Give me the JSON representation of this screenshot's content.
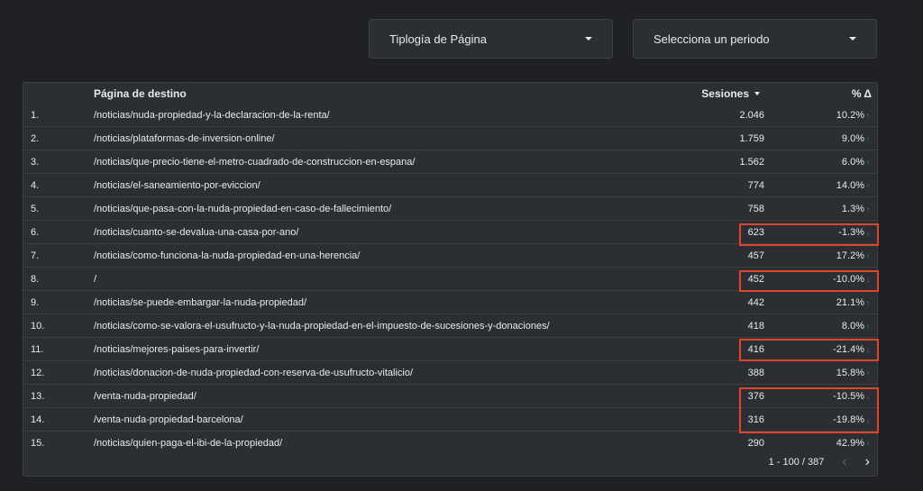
{
  "filters": {
    "tipologia": "Tiplogía de Página",
    "periodo": "Selecciona un periodo"
  },
  "table": {
    "headers": {
      "page": "Página de destino",
      "sessions": "Sesiones",
      "delta": "% Δ"
    },
    "rows": [
      {
        "idx": "1.",
        "page": "/noticias/nuda-propiedad-y-la-declaracion-de-la-renta/",
        "sessions": "2.046",
        "delta": "10.2%",
        "dir": "up"
      },
      {
        "idx": "2.",
        "page": "/noticias/plataformas-de-inversion-online/",
        "sessions": "1.759",
        "delta": "9.0%",
        "dir": "up"
      },
      {
        "idx": "3.",
        "page": "/noticias/que-precio-tiene-el-metro-cuadrado-de-construccion-en-espana/",
        "sessions": "1.562",
        "delta": "6.0%",
        "dir": "up"
      },
      {
        "idx": "4.",
        "page": "/noticias/el-saneamiento-por-eviccion/",
        "sessions": "774",
        "delta": "14.0%",
        "dir": "up"
      },
      {
        "idx": "5.",
        "page": "/noticias/que-pasa-con-la-nuda-propiedad-en-caso-de-fallecimiento/",
        "sessions": "758",
        "delta": "1.3%",
        "dir": "up"
      },
      {
        "idx": "6.",
        "page": "/noticias/cuanto-se-devalua-una-casa-por-ano/",
        "sessions": "623",
        "delta": "-1.3%",
        "dir": "down"
      },
      {
        "idx": "7.",
        "page": "/noticias/como-funciona-la-nuda-propiedad-en-una-herencia/",
        "sessions": "457",
        "delta": "17.2%",
        "dir": "up"
      },
      {
        "idx": "8.",
        "page": "/",
        "sessions": "452",
        "delta": "-10.0%",
        "dir": "down"
      },
      {
        "idx": "9.",
        "page": "/noticias/se-puede-embargar-la-nuda-propiedad/",
        "sessions": "442",
        "delta": "21.1%",
        "dir": "up"
      },
      {
        "idx": "10.",
        "page": "/noticias/como-se-valora-el-usufructo-y-la-nuda-propiedad-en-el-impuesto-de-sucesiones-y-donaciones/",
        "sessions": "418",
        "delta": "8.0%",
        "dir": "up"
      },
      {
        "idx": "11.",
        "page": "/noticias/mejores-paises-para-invertir/",
        "sessions": "416",
        "delta": "-21.4%",
        "dir": "down"
      },
      {
        "idx": "12.",
        "page": "/noticias/donacion-de-nuda-propiedad-con-reserva-de-usufructo-vitalicio/",
        "sessions": "388",
        "delta": "15.8%",
        "dir": "up"
      },
      {
        "idx": "13.",
        "page": "/venta-nuda-propiedad/",
        "sessions": "376",
        "delta": "-10.5%",
        "dir": "down"
      },
      {
        "idx": "14.",
        "page": "/venta-nuda-propiedad-barcelona/",
        "sessions": "316",
        "delta": "-19.8%",
        "dir": "down"
      },
      {
        "idx": "15.",
        "page": "/noticias/quien-paga-el-ibi-de-la-propiedad/",
        "sessions": "290",
        "delta": "42.9%",
        "dir": "up"
      }
    ],
    "pagination": "1 - 100 / 387"
  },
  "icons": {
    "up": "arrow-up-icon",
    "down": "arrow-down-icon",
    "prev": "chevron-left-icon",
    "next": "chevron-right-icon"
  },
  "colors": {
    "up": "#34a853",
    "down": "#ea4335",
    "highlight": "#e0452a"
  }
}
